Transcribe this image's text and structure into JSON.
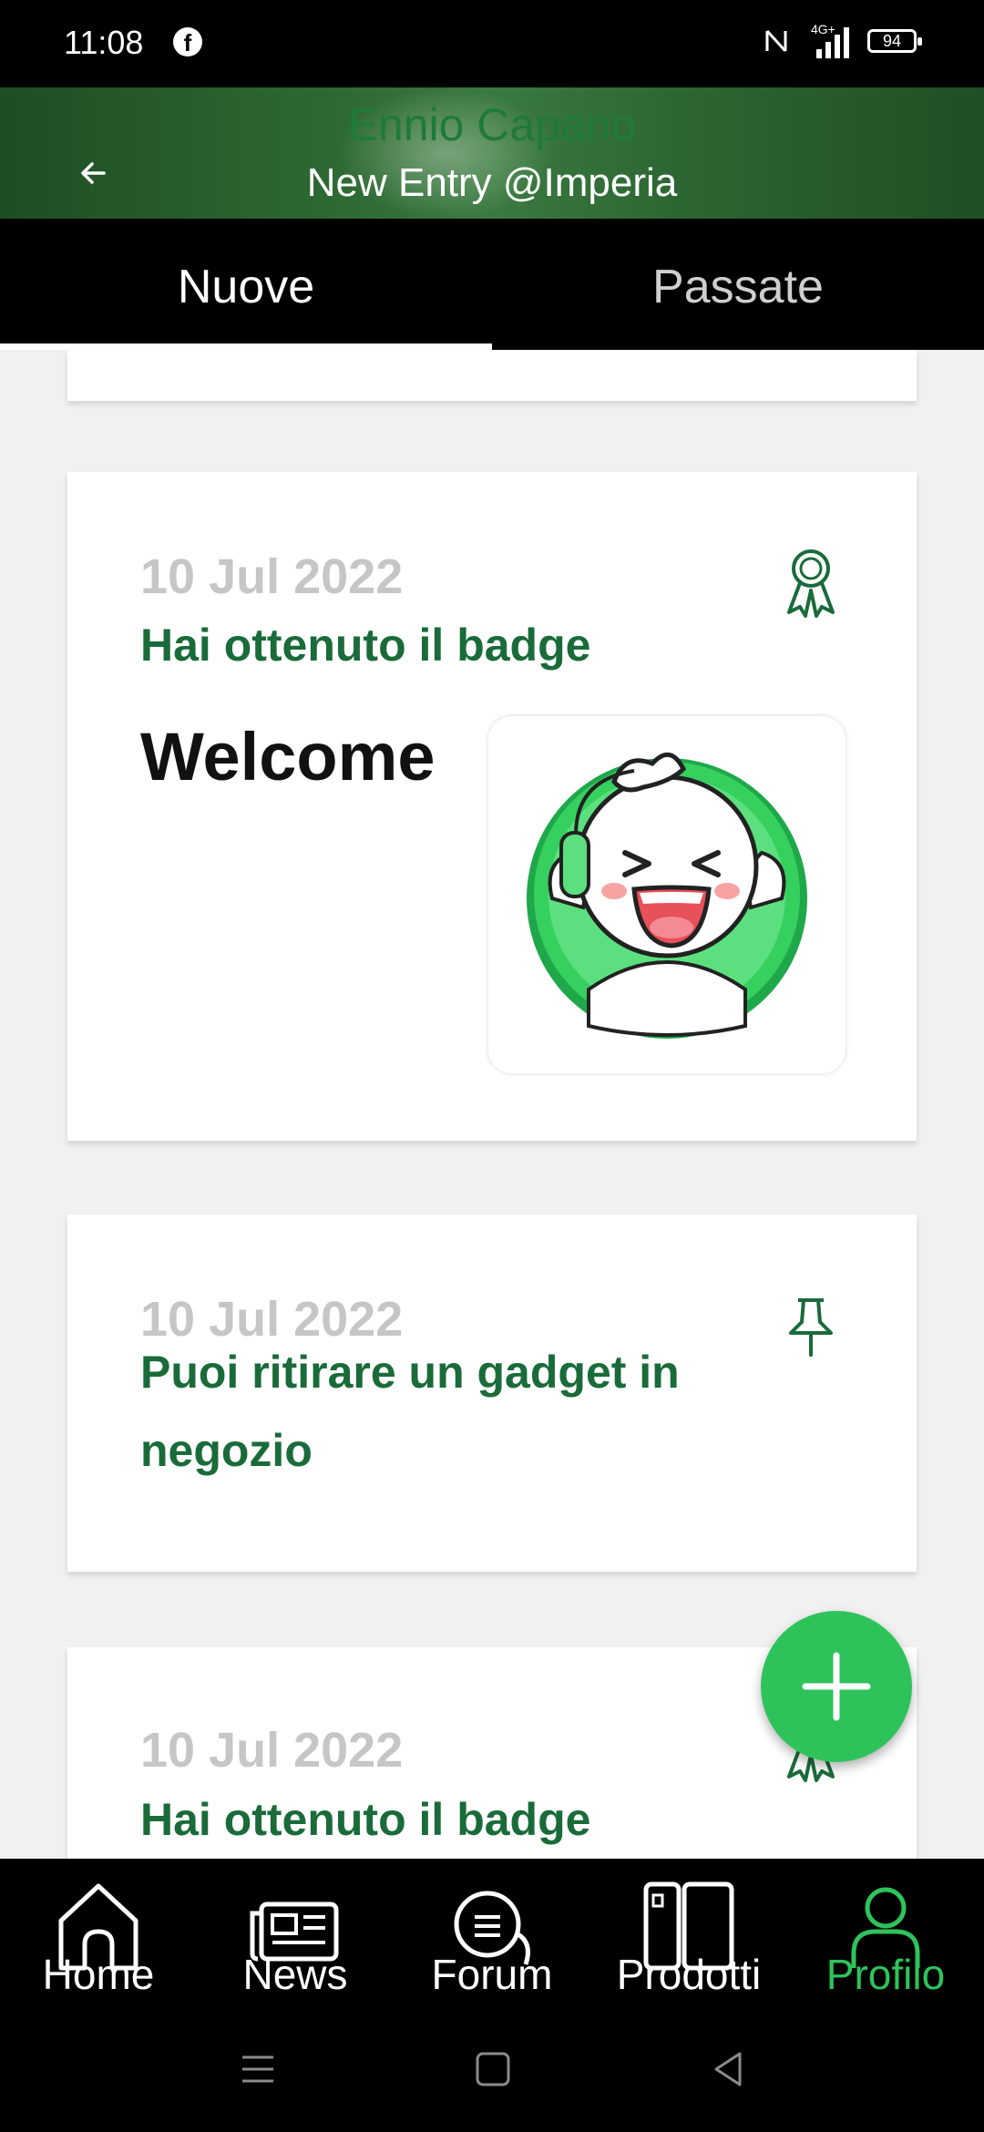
{
  "status_bar": {
    "time": "11:08",
    "network": "4G+",
    "battery": "94"
  },
  "header": {
    "user_name": "Ennio Capano",
    "title": "New Entry @Imperia"
  },
  "tabs": [
    {
      "label": "Nuove",
      "active": true
    },
    {
      "label": "Passate",
      "active": false
    }
  ],
  "feed": [
    {
      "date": "10 Jul 2022",
      "title": "Hai ottenuto il badge",
      "badge_name": "Welcome",
      "icon": "award-ribbon-icon"
    },
    {
      "date": "10 Jul 2022",
      "title_line1": "Puoi ritirare un gadget in",
      "title_line2": "negozio",
      "icon": "pin-icon"
    },
    {
      "date": "10 Jul 2022",
      "title": "Hai ottenuto il badge",
      "icon": "award-ribbon-icon"
    }
  ],
  "fab": {
    "icon": "plus-icon"
  },
  "bottom_nav": [
    {
      "label": "Home",
      "icon": "home-icon"
    },
    {
      "label": "News",
      "icon": "newspaper-icon"
    },
    {
      "label": "Forum",
      "icon": "chat-bubbles-icon"
    },
    {
      "label": "Prodotti",
      "icon": "devices-icon"
    },
    {
      "label": "Profilo",
      "icon": "person-icon",
      "active": true
    }
  ],
  "colors": {
    "accent_green": "#2ec35a",
    "title_green": "#1a6b3a",
    "header_green": "#2e6a34"
  }
}
